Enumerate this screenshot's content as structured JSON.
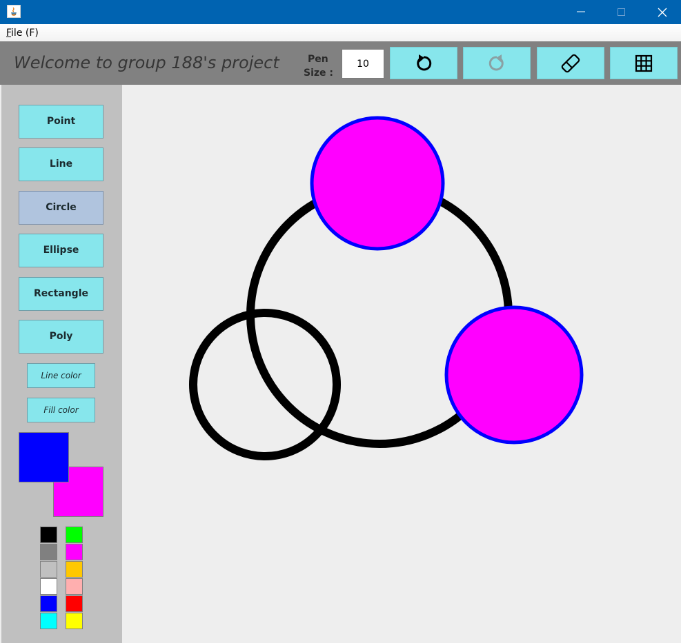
{
  "menu": {
    "file_hotkey": "F",
    "file_rest": "ile (F)"
  },
  "toolbar": {
    "welcome": "Welcome to group 188's project",
    "pen_label_1": "Pen",
    "pen_label_2": "Size :",
    "pen_size": "10",
    "buttons": [
      {
        "icon": "undo-icon"
      },
      {
        "icon": "redo-icon"
      },
      {
        "icon": "eraser-icon"
      },
      {
        "icon": "grid-icon"
      }
    ]
  },
  "sidebar": {
    "shapes": [
      "Point",
      "Line",
      "Circle",
      "Ellipse",
      "Rectangle",
      "Poly"
    ],
    "selected_shape": "Circle",
    "line_color_label": "Line color",
    "fill_color_label": "Fill color",
    "current_line_color": "#0000ff",
    "current_fill_color": "#ff00ff",
    "palette": [
      "#000000",
      "#00ff00",
      "#808080",
      "#ff00ff",
      "#c0c0c0",
      "#ffc800",
      "#ffffff",
      "#ffafaf",
      "#0000ff",
      "#ff0000",
      "#00ffff",
      "#ffff00"
    ]
  },
  "colors": {
    "titlebar": "#0063b1",
    "toolbar_bg": "#818181",
    "button_bg": "#87e6ec",
    "selected_bg": "#b0c4de"
  }
}
